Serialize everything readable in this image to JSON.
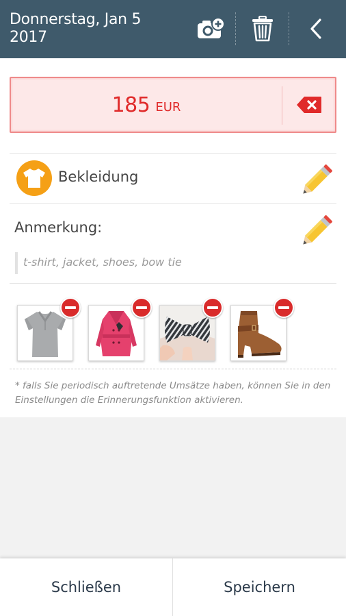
{
  "header": {
    "date_line1": "Donnerstag, Jan 5",
    "date_line2": "2017",
    "icons": [
      "add-photo-icon",
      "trash-icon",
      "back-chevron-icon"
    ],
    "background": "#3f5a6b"
  },
  "amount": {
    "value": "185",
    "currency": "EUR",
    "color": "#e02a2a",
    "clear_icon": "backspace-icon"
  },
  "category": {
    "label": "Bekleidung",
    "icon": "tshirt-icon",
    "icon_color": "#f5a016"
  },
  "note": {
    "label": "Anmerkung:",
    "text": "t-shirt, jacket, shoes, bow tie"
  },
  "photos": [
    {
      "subject": "grey polo shirt",
      "remove_icon": "remove-icon"
    },
    {
      "subject": "pink coat",
      "remove_icon": "remove-icon"
    },
    {
      "subject": "striped bow tie",
      "remove_icon": "remove-icon"
    },
    {
      "subject": "brown ankle boot",
      "remove_icon": "remove-icon"
    }
  ],
  "footnote": "* falls Sie periodisch auftretende Umsätze haben, können Sie in den Einstellungen die Erinnerungsfunktion aktivieren.",
  "buttons": {
    "close": "Schließen",
    "save": "Speichern"
  }
}
